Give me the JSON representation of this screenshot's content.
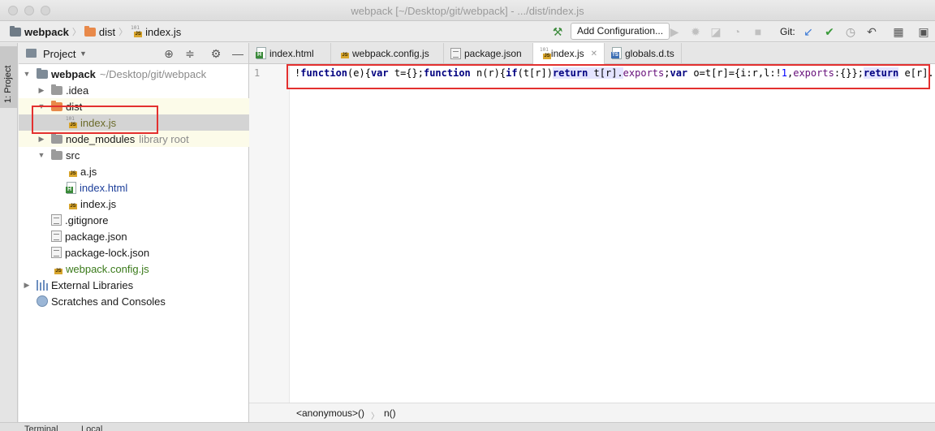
{
  "window": {
    "title": "webpack [~/Desktop/git/webpack] - .../dist/index.js"
  },
  "navbar": {
    "crumbs": [
      "webpack",
      "dist",
      "index.js"
    ],
    "add_configuration": "Add Configuration...",
    "git_label": "Git:"
  },
  "side_strip": {
    "project_tab": "1: Project"
  },
  "project_panel": {
    "title": "Project",
    "tree": [
      {
        "label": "webpack",
        "note": "~/Desktop/git/webpack"
      },
      {
        "label": ".idea"
      },
      {
        "label": "dist"
      },
      {
        "label": "index.js"
      },
      {
        "label": "node_modules",
        "note": "library root"
      },
      {
        "label": "src"
      },
      {
        "label": "a.js"
      },
      {
        "label": "index.html"
      },
      {
        "label": "index.js"
      },
      {
        "label": ".gitignore"
      },
      {
        "label": "package.json"
      },
      {
        "label": "package-lock.json"
      },
      {
        "label": "webpack.config.js"
      },
      {
        "label": "External Libraries"
      },
      {
        "label": "Scratches and Consoles"
      }
    ]
  },
  "tabs": [
    {
      "label": "index.html"
    },
    {
      "label": "webpack.config.js"
    },
    {
      "label": "package.json"
    },
    {
      "label": "index.js"
    },
    {
      "label": "globals.d.ts"
    }
  ],
  "editor": {
    "line_number": "1",
    "code": {
      "t1": "!",
      "t2": "function",
      "t3": "(e){",
      "t4": "var",
      "t5": " t={};",
      "t6": "function",
      "t7": " n(r){",
      "t8": "if",
      "t9": "(t[r])",
      "t10": "return",
      "t11": " t[r].",
      "t12": "exports",
      "t13": ";",
      "t14": "var",
      "t15": " o=t[r]={i:r,l:!",
      "t16": "1",
      "t17": ",",
      "t18": "exports",
      "t19": ":{}};",
      "t20": "return",
      "t21": " e[r].cal"
    },
    "breadcrumbs": [
      "<anonymous>()",
      "n()"
    ]
  },
  "bottom_bar": {
    "items": [
      "Terminal",
      "Local"
    ]
  },
  "colors": {
    "annotation": "#e3302f",
    "js_badge": "#d9a62e",
    "folder_orange": "#e8894a",
    "folder_gray": "#9b9b9b"
  }
}
